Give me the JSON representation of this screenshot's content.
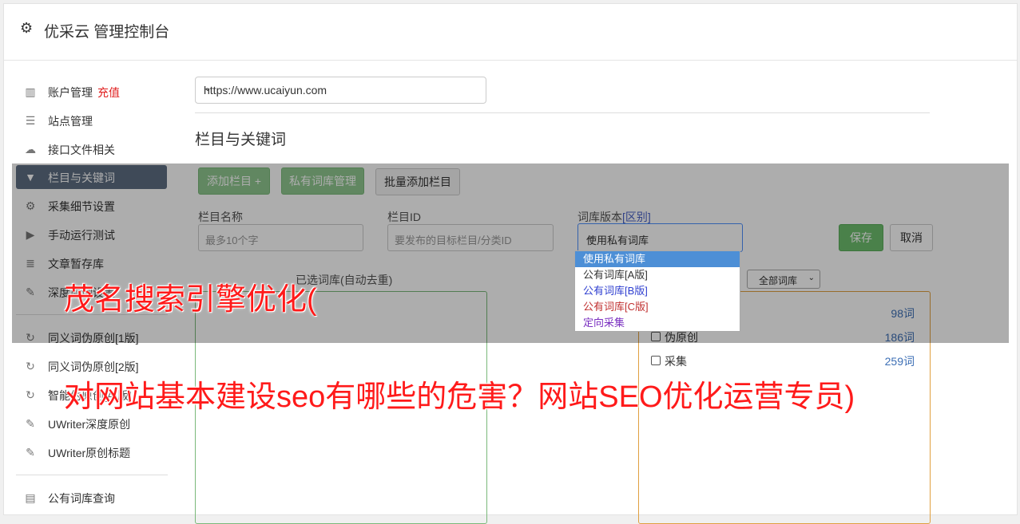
{
  "header": {
    "title": "优采云 管理控制台"
  },
  "sidebar": {
    "items": [
      {
        "label": "账户管理",
        "extra": "充值",
        "icon": "bar-chart-icon"
      },
      {
        "label": "站点管理",
        "icon": "server-icon"
      },
      {
        "label": "接口文件相关",
        "icon": "cloud-upload-icon"
      },
      {
        "label": "栏目与关键词",
        "icon": "filter-icon"
      },
      {
        "label": "采集细节设置",
        "icon": "gears-icon"
      },
      {
        "label": "手动运行测试",
        "icon": "play-circle-icon"
      },
      {
        "label": "文章暂存库",
        "icon": "database-icon"
      },
      {
        "label": "深度原创设置",
        "icon": "edit-icon"
      },
      {
        "label": "同义词伪原创[1版]",
        "icon": "refresh-icon"
      },
      {
        "label": "同义词伪原创[2版]",
        "icon": "refresh-icon"
      },
      {
        "label": "智能伪原创[AI版]",
        "icon": "refresh-icon"
      },
      {
        "label": "UWriter深度原创",
        "icon": "edit-icon"
      },
      {
        "label": "UWriter原创标题",
        "icon": "edit-icon"
      },
      {
        "label": "公有词库查询",
        "icon": "book-icon"
      }
    ]
  },
  "main": {
    "site_select": {
      "value": "https://www.ucaiyun.com"
    },
    "section_title": "栏目与关键词",
    "buttons": {
      "add_column": "添加栏目 +",
      "private_lib": "私有词库管理",
      "batch_add": "批量添加栏目",
      "save": "保存",
      "cancel": "取消"
    },
    "form": {
      "column_name_label": "栏目名称",
      "column_name_placeholder": "最多10个字",
      "column_id_label": "栏目ID",
      "column_id_placeholder": "要发布的目标栏目/分类ID",
      "lib_version_label": "词库版本",
      "lib_version_link": "[区别]",
      "lib_version_value": "使用私有词库"
    },
    "dropdown_options": [
      "使用私有词库",
      "公有词库[A版]",
      "公有词库[B版]",
      "公有词库[C版]",
      "定向采集"
    ],
    "selected_panel_title": "已选词库(自动去重)",
    "all_lib_select": "全部词库",
    "library_rows": [
      {
        "name": "",
        "count": "98词"
      },
      {
        "name": "伪原创",
        "count": "186词"
      },
      {
        "name": "采集",
        "count": "259词"
      }
    ]
  },
  "watermark": {
    "line1": "茂名搜索引擎优化(",
    "line2": "对网站基本建设seo有哪些的危害？网站SEO优化运营专员)"
  },
  "colors": {
    "active_nav": "#5d6d82",
    "recharge": "#e02020",
    "watermark": "#ff1a1a",
    "option_b": "#2f3fd0",
    "option_c": "#c03030",
    "option_target": "#7a2fc0"
  }
}
